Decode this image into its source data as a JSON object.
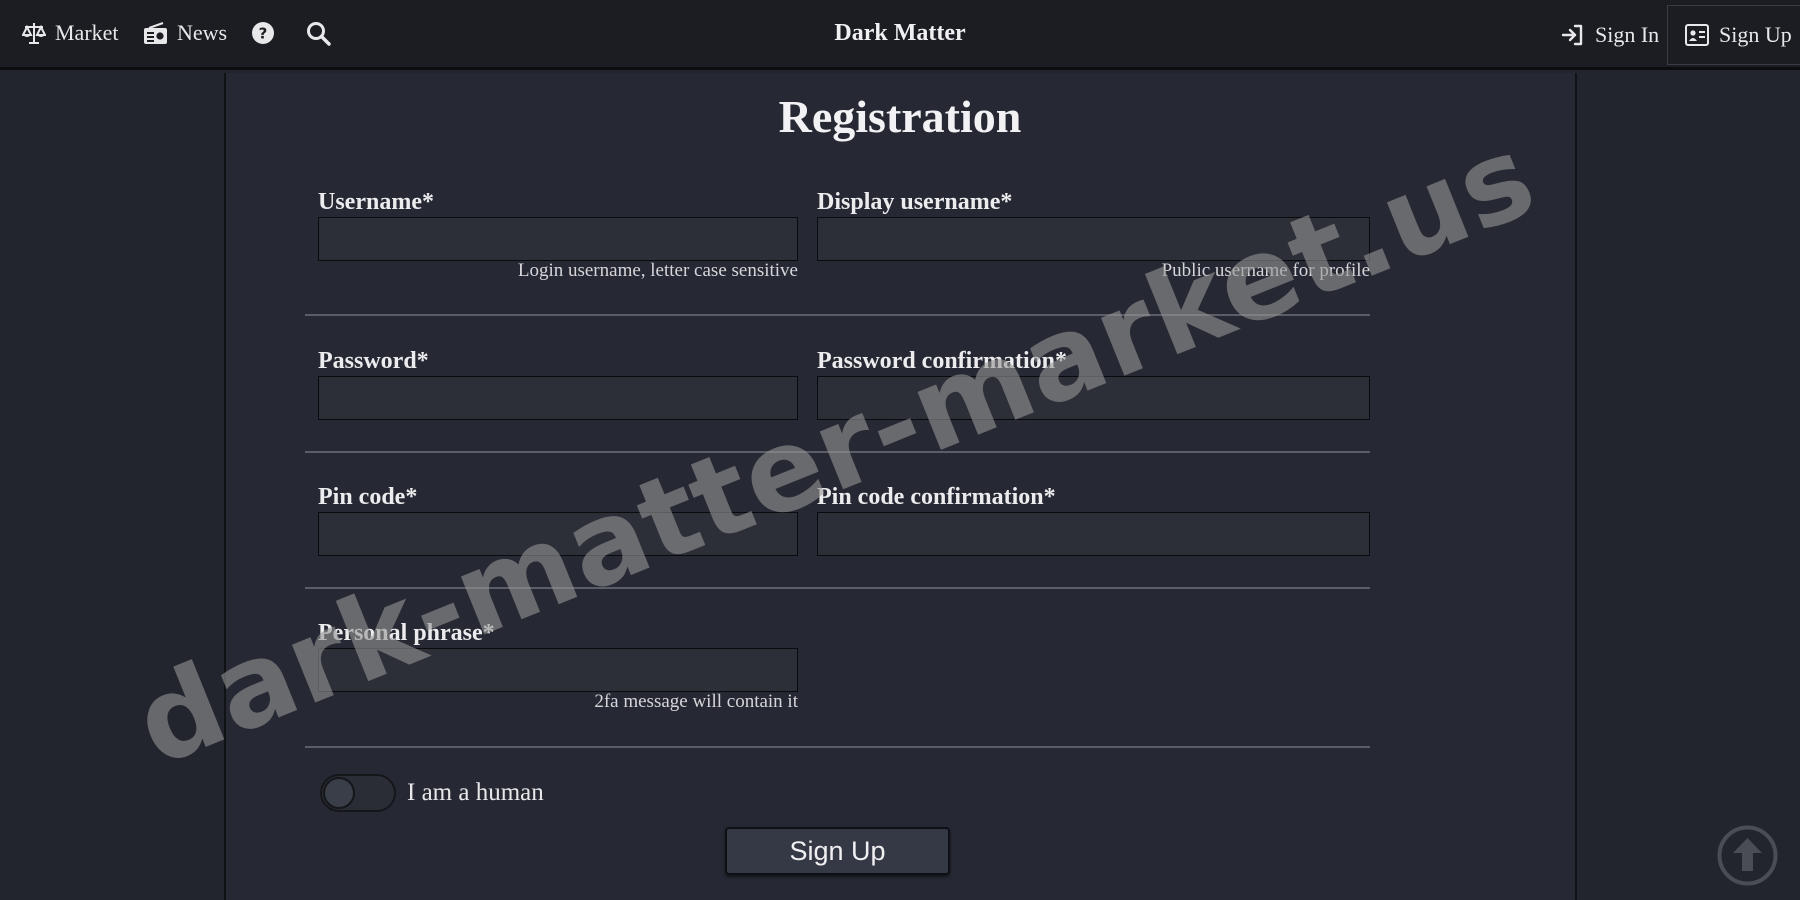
{
  "nav": {
    "market_label": "Market",
    "news_label": "News",
    "brand": "Dark Matter",
    "signin_label": "Sign In",
    "signup_label": "Sign Up",
    "icons": [
      "scale-icon",
      "radio-icon",
      "help-icon",
      "search-icon",
      "sign-in-icon",
      "id-card-icon"
    ]
  },
  "page": {
    "title": "Registration"
  },
  "form": {
    "username": {
      "label": "Username*",
      "value": "",
      "hint": "Login username, letter case sensitive"
    },
    "display_username": {
      "label": "Display username*",
      "value": "",
      "hint": "Public username for profile"
    },
    "password": {
      "label": "Password*",
      "value": ""
    },
    "password_confirmation": {
      "label": "Password confirmation*",
      "value": ""
    },
    "pin_code": {
      "label": "Pin code*",
      "value": ""
    },
    "pin_code_confirmation": {
      "label": "Pin code confirmation*",
      "value": ""
    },
    "personal_phrase": {
      "label": "Personal phrase*",
      "value": "",
      "hint": "2fa message will contain it"
    },
    "human_check": {
      "label": "I am a human",
      "checked": false
    },
    "submit_label": "Sign Up"
  },
  "watermark": "dark-matter-market.us",
  "colors": {
    "background": "#22252e",
    "topbar": "#1b1d23",
    "panel": "#262933",
    "input": "#2c2f38",
    "text": "#e8e8ea"
  }
}
